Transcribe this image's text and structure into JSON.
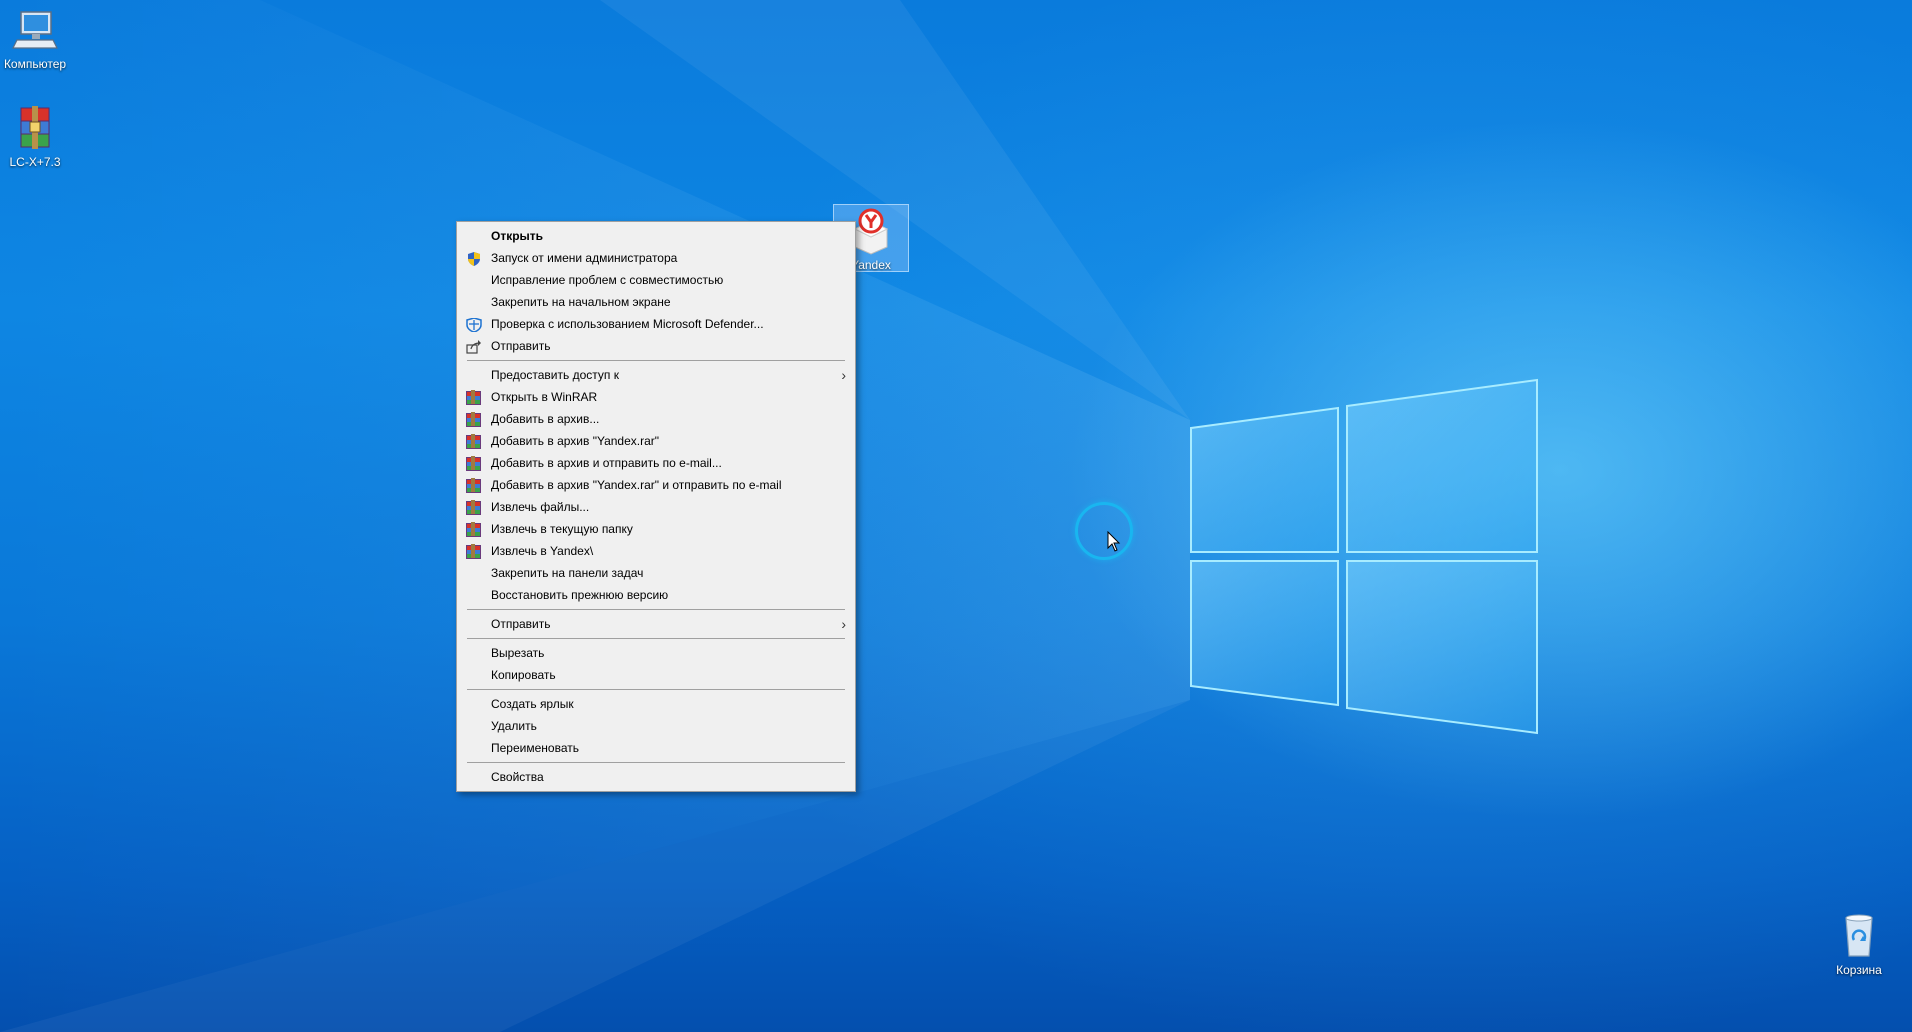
{
  "desktop": {
    "icons": [
      {
        "label": "Компьютер",
        "icon": "computer-icon"
      },
      {
        "label": "LC-X+7.3",
        "icon": "winrar-archive-icon"
      },
      {
        "label": "Yandex",
        "icon": "yandex-installer-icon"
      },
      {
        "label": "Корзина",
        "icon": "recycle-bin-icon"
      }
    ]
  },
  "context_menu": {
    "group1": [
      {
        "label": "Открыть",
        "icon": ""
      },
      {
        "label": "Запуск от имени администратора",
        "icon": "uac-shield-icon"
      },
      {
        "label": "Исправление проблем с совместимостью",
        "icon": ""
      },
      {
        "label": "Закрепить на начальном экране",
        "icon": ""
      },
      {
        "label": "Проверка с использованием Microsoft Defender...",
        "icon": "defender-icon"
      },
      {
        "label": "Отправить",
        "icon": "share-icon"
      }
    ],
    "group2": [
      {
        "label": "Предоставить доступ к",
        "icon": "",
        "submenu": true
      },
      {
        "label": "Открыть в WinRAR",
        "icon": "winrar-icon"
      },
      {
        "label": "Добавить в архив...",
        "icon": "winrar-icon"
      },
      {
        "label": "Добавить в архив \"Yandex.rar\"",
        "icon": "winrar-icon"
      },
      {
        "label": "Добавить в архив и отправить по e-mail...",
        "icon": "winrar-icon"
      },
      {
        "label": "Добавить в архив \"Yandex.rar\" и отправить по e-mail",
        "icon": "winrar-icon"
      },
      {
        "label": "Извлечь файлы...",
        "icon": "winrar-icon"
      },
      {
        "label": "Извлечь в текущую папку",
        "icon": "winrar-icon"
      },
      {
        "label": "Извлечь в Yandex\\",
        "icon": "winrar-icon"
      },
      {
        "label": "Закрепить на панели задач",
        "icon": ""
      },
      {
        "label": "Восстановить прежнюю версию",
        "icon": ""
      }
    ],
    "group3": [
      {
        "label": "Отправить",
        "icon": "",
        "submenu": true
      }
    ],
    "group4": [
      {
        "label": "Вырезать",
        "icon": ""
      },
      {
        "label": "Копировать",
        "icon": ""
      }
    ],
    "group5": [
      {
        "label": "Создать ярлык",
        "icon": ""
      },
      {
        "label": "Удалить",
        "icon": ""
      },
      {
        "label": "Переименовать",
        "icon": ""
      }
    ],
    "group6": [
      {
        "label": "Свойства",
        "icon": ""
      }
    ]
  },
  "colors": {
    "menu_bg": "#f0f0f0",
    "desktop_blue": "#0a7bdc",
    "cursor_ring": "#19b6f0"
  }
}
